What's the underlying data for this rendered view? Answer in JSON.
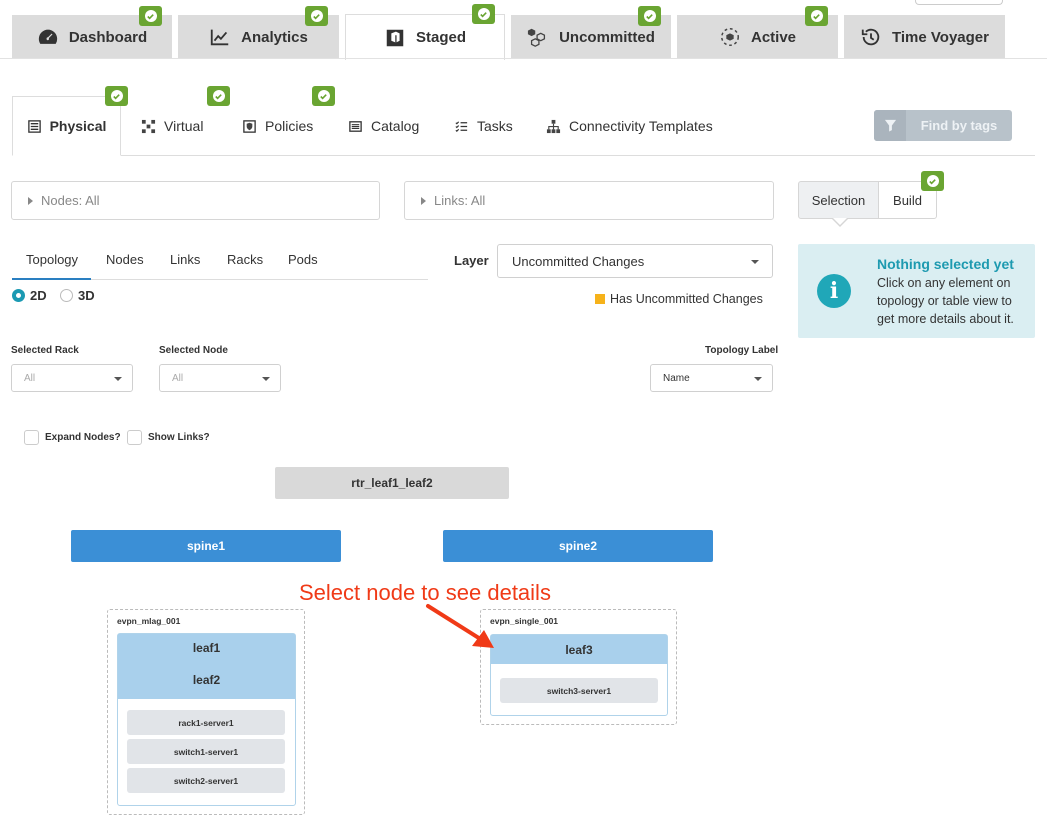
{
  "top_tabs": [
    {
      "label": "Dashboard",
      "icon": "dashboard-gauge-icon",
      "active": false,
      "badge": true
    },
    {
      "label": "Analytics",
      "icon": "analytics-chart-icon",
      "active": false,
      "badge": true
    },
    {
      "label": "Staged",
      "icon": "staged-box-icon",
      "active": true,
      "badge": true
    },
    {
      "label": "Uncommitted",
      "icon": "uncommitted-cubes-icon",
      "active": false,
      "badge": true
    },
    {
      "label": "Active",
      "icon": "active-cube-icon",
      "active": false,
      "badge": true
    },
    {
      "label": "Time Voyager",
      "icon": "history-icon",
      "active": false,
      "badge": false
    }
  ],
  "sub_tabs": [
    {
      "label": "Physical",
      "icon": "physical-server-icon",
      "active": true
    },
    {
      "label": "Virtual",
      "icon": "virtual-network-icon"
    },
    {
      "label": "Policies",
      "icon": "policies-shield-icon"
    },
    {
      "label": "Catalog",
      "icon": "catalog-list-icon"
    },
    {
      "label": "Tasks",
      "icon": "tasks-checklist-icon"
    },
    {
      "label": "Connectivity Templates",
      "icon": "connectivity-templates-icon"
    }
  ],
  "find_by_tags": "Find by tags",
  "filters": {
    "nodes": "Nodes: All",
    "links": "Links: All"
  },
  "panel": {
    "selection_label": "Selection",
    "build_label": "Build",
    "info_title": "Nothing selected yet",
    "info_text": "Click on any element on topology or table view to get more details about it."
  },
  "view_tabs": [
    "Topology",
    "Nodes",
    "Links",
    "Racks",
    "Pods"
  ],
  "radio": {
    "opt1": "2D",
    "opt2": "3D"
  },
  "layer": {
    "label": "Layer",
    "value": "Uncommitted Changes",
    "legend": "Has Uncommitted Changes"
  },
  "selectors": {
    "rack_label": "Selected Rack",
    "rack_value": "All",
    "node_label": "Selected Node",
    "node_value": "All",
    "topo_label": "Topology Label",
    "topo_value": "Name"
  },
  "checks": {
    "expand": "Expand Nodes?",
    "links": "Show Links?"
  },
  "topology": {
    "external_router": "rtr_leaf1_leaf2",
    "spines": [
      "spine1",
      "spine2"
    ],
    "rack1": {
      "name": "evpn_mlag_001",
      "leaves": [
        "leaf1",
        "leaf2"
      ],
      "servers": [
        "rack1-server1",
        "switch1-server1",
        "switch2-server1"
      ]
    },
    "rack2": {
      "name": "evpn_single_001",
      "leaves": [
        "leaf3"
      ],
      "servers": [
        "switch3-server1"
      ]
    }
  },
  "annotation": "Select node to see details",
  "colors": {
    "badge": "#6aa532",
    "spine": "#3b8fd6",
    "leaf": "#a9d0ec",
    "info_bg": "#daeef2",
    "accent": "#1b9ab3",
    "uncommitted": "#f6b21a",
    "annotation": "#f03a17"
  }
}
